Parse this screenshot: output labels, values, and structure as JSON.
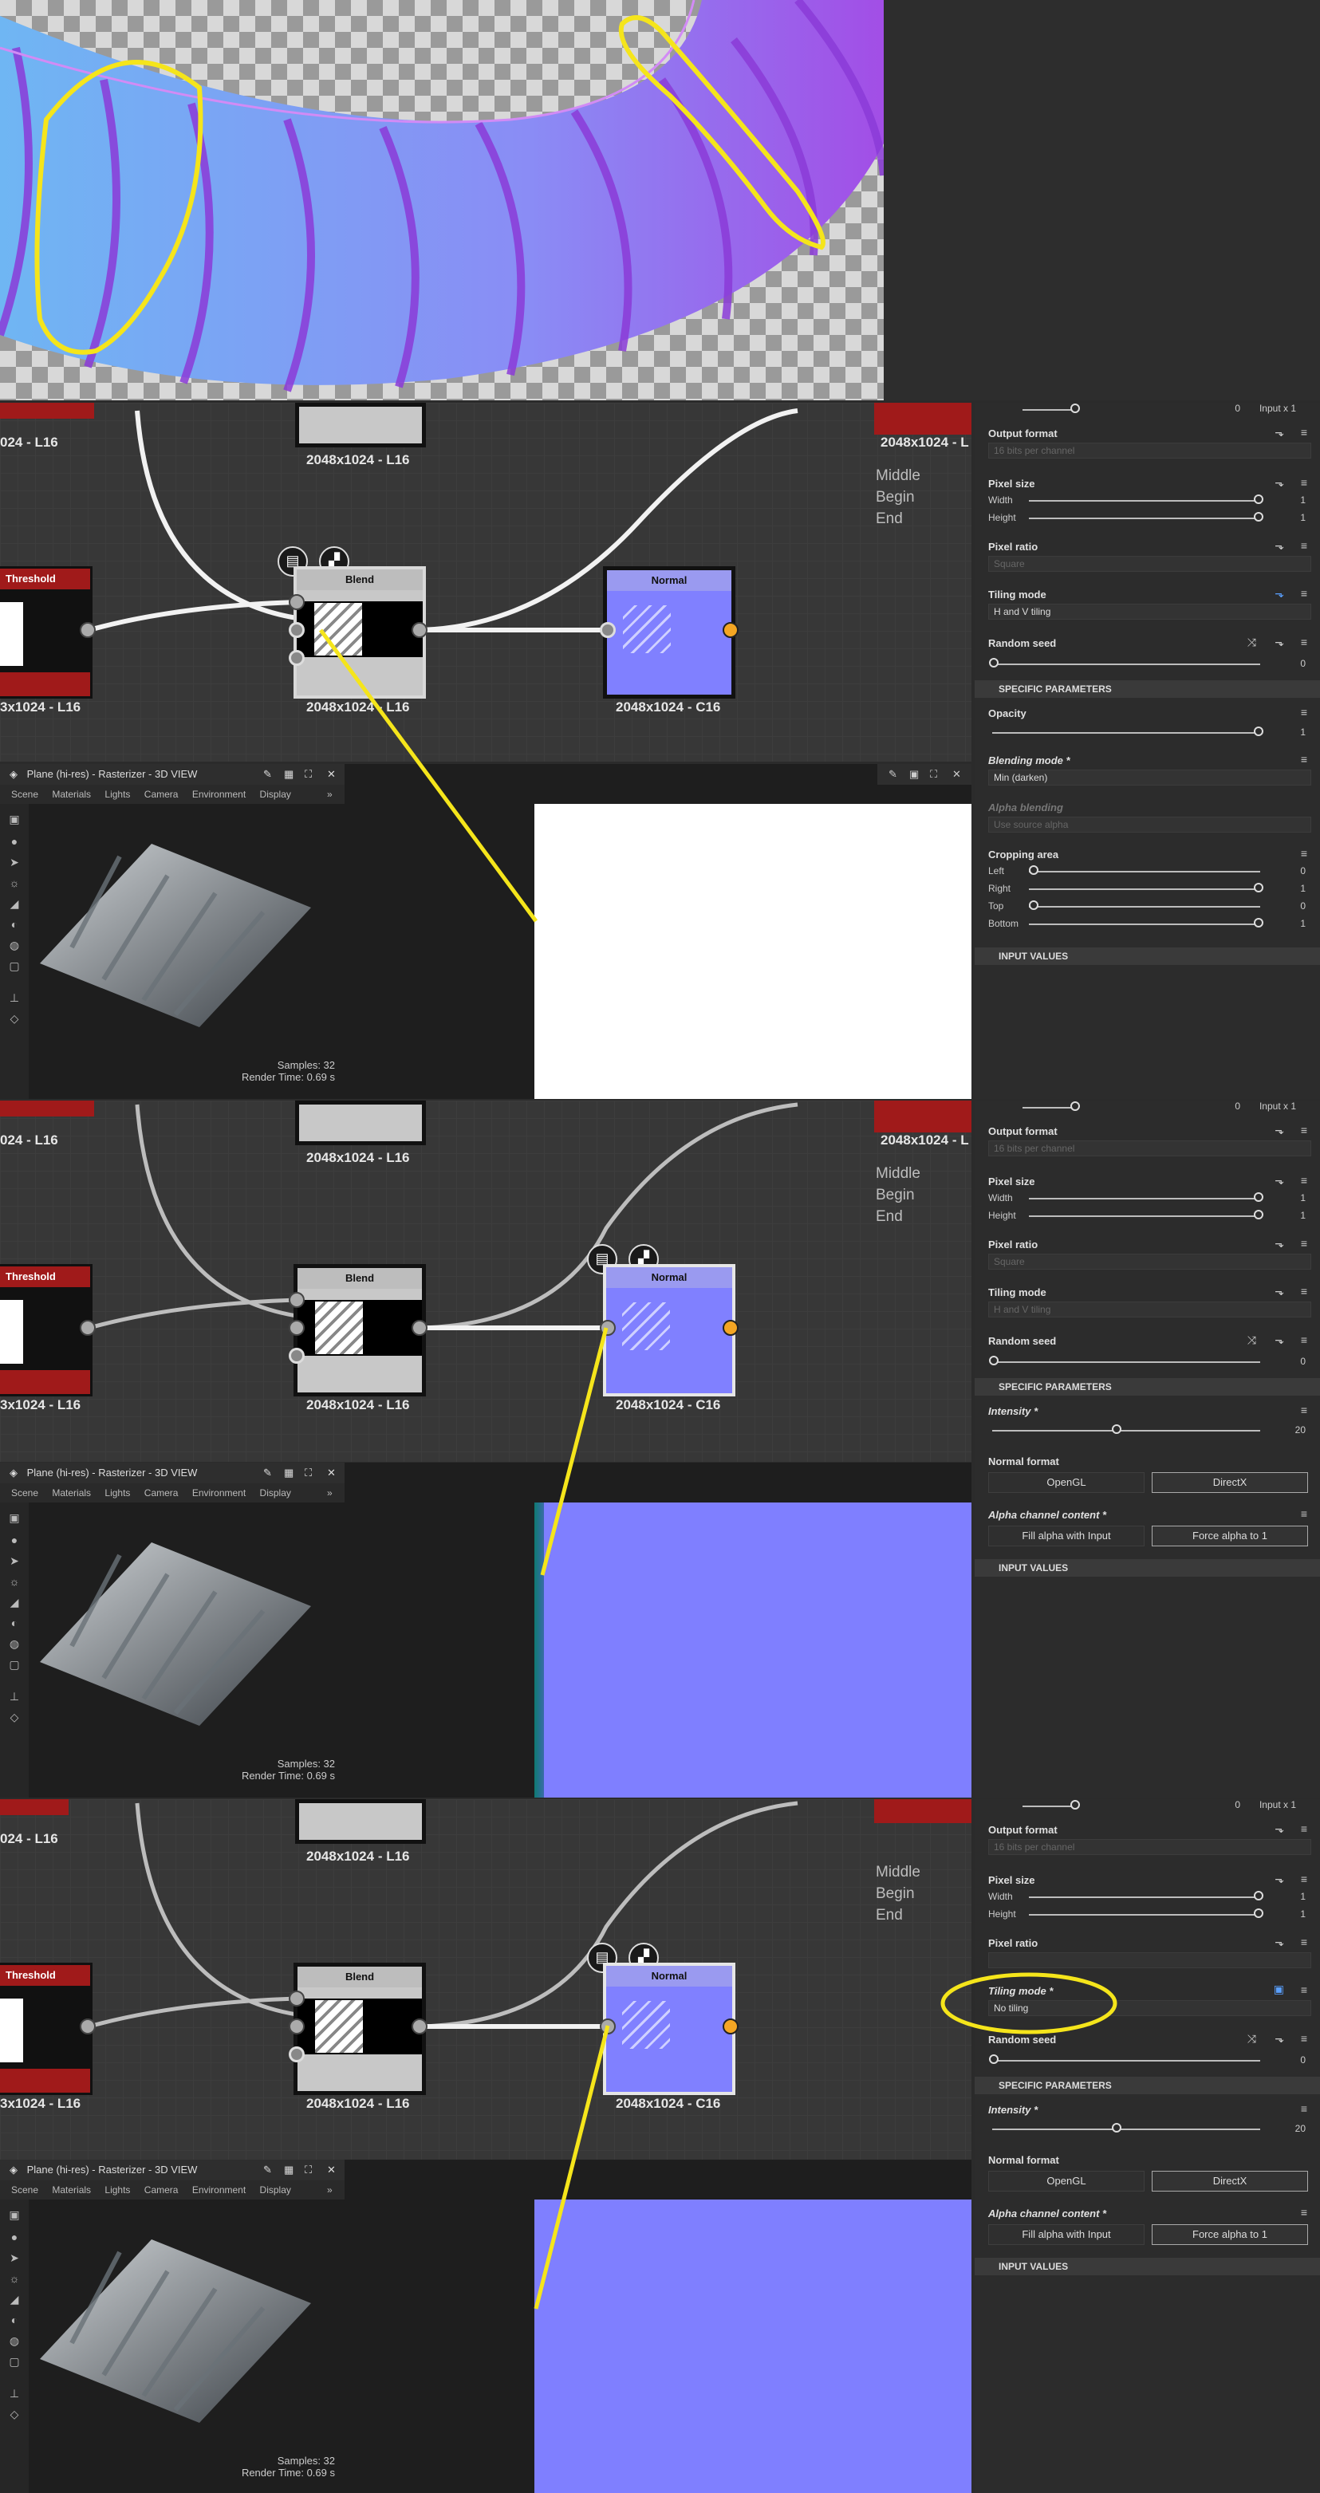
{
  "graph": {
    "node_size_labels": {
      "left": "3x1024 - L16",
      "top_left": "024 - L16",
      "blend_top": "2048x1024 - L16",
      "top_right": "2048x1024 - L",
      "blend": "2048x1024 - L16",
      "normal": "2048x1024 - C16"
    },
    "legend": [
      "Middle",
      "Begin",
      "End"
    ],
    "nodes": {
      "threshold": "Threshold",
      "blend": "Blend",
      "normal": "Normal"
    }
  },
  "view3d": {
    "title": "Plane (hi-res) - Rasterizer - 3D VIEW",
    "tabs": [
      "Scene",
      "Materials",
      "Lights",
      "Camera",
      "Environment",
      "Display"
    ],
    "more": "»",
    "samples": "Samples: 32",
    "render_time": "Render Time: 0.69 s"
  },
  "panel_common": {
    "height_top": "Height",
    "height_top_val": "0",
    "height_top_input": "Input x 1",
    "output_format": "Output format",
    "output_format_value": "16 bits per channel",
    "pixel_size": "Pixel size",
    "width": "Width",
    "width_val": "1",
    "height": "Height",
    "height_val": "1",
    "pixel_ratio": "Pixel ratio",
    "pixel_ratio_value": "Square",
    "random_seed": "Random seed",
    "random_seed_val": "0",
    "specific": "SPECIFIC PARAMETERS",
    "input_values": "INPUT VALUES"
  },
  "panel1": {
    "tiling_mode": "Tiling mode",
    "tiling_value": "H and V tiling",
    "opacity": "Opacity",
    "opacity_val": "1",
    "blending_mode": "Blending mode *",
    "blending_value": "Min (darken)",
    "alpha_blending": "Alpha blending",
    "alpha_blending_value": "Use source alpha",
    "cropping": "Cropping area",
    "left": "Left",
    "left_val": "0",
    "right": "Right",
    "right_val": "1",
    "top": "Top",
    "top_val": "0",
    "bottom": "Bottom",
    "bottom_val": "1"
  },
  "panel2": {
    "tiling_mode": "Tiling mode",
    "tiling_value": "H and V tiling",
    "intensity": "Intensity *",
    "intensity_val": "20",
    "normal_format": "Normal format",
    "opengl": "OpenGL",
    "directx": "DirectX",
    "alpha_content": "Alpha channel content *",
    "fill_alpha": "Fill alpha with Input",
    "force_alpha": "Force alpha to 1"
  },
  "panel3": {
    "tiling_mode": "Tiling mode *",
    "tiling_value": "No tiling",
    "intensity": "Intensity *",
    "intensity_val": "20",
    "normal_format": "Normal format",
    "opengl": "OpenGL",
    "directx": "DirectX",
    "alpha_content": "Alpha channel content *",
    "fill_alpha": "Fill alpha with Input",
    "force_alpha": "Force alpha to 1"
  },
  "colors": {
    "normal_blue": "#8080ff",
    "annotation": "#f5e51b",
    "threshold_red": "#a01a1a",
    "pin_orange": "#f5a623"
  }
}
